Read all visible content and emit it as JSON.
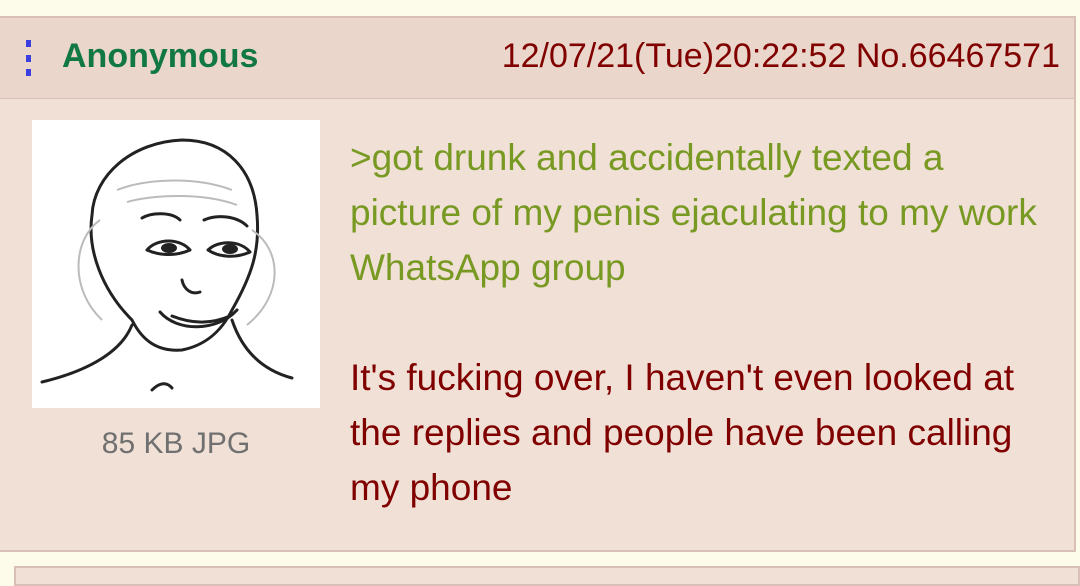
{
  "post": {
    "name": "Anonymous",
    "datetime": "12/07/21(Tue)20:22:52 No.66467571",
    "menu_icon": "vertical-ellipsis-icon",
    "file": {
      "info": "85 KB JPG",
      "thumbnail_icon": "wojak-face-icon"
    },
    "greentext": ">got drunk and accidentally texted a picture of my penis ejaculating to my work WhatsApp group",
    "body": "It's fucking over, I haven't even looked at the replies and people have been calling my phone"
  },
  "colors": {
    "background": "#fdfbe9",
    "post_bg": "#f0e0d6",
    "header_bg": "#ead6ca",
    "border": "#d9bfb7",
    "name": "#117743",
    "text": "#800000",
    "greentext": "#789922",
    "menu_icon": "#3b3fe0"
  }
}
